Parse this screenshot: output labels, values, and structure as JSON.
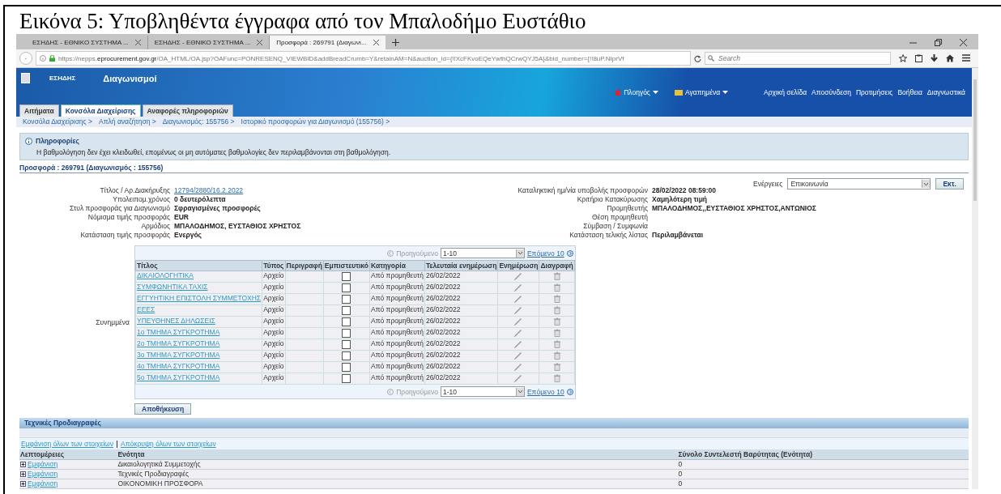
{
  "caption": "Εικόνα 5: Υποβληθέντα έγγραφα από τον Μπαλοδήμο Ευστάθιο",
  "browser": {
    "tabs": [
      {
        "label": "ΕΣΗΔΗΣ - ΕΘΝΙΚΟ ΣΥΣΤΗΜΑ ...",
        "selected": false
      },
      {
        "label": "ΕΣΗΔΗΣ - ΕΘΝΙΚΟ ΣΥΣΤΗΜΑ ...",
        "selected": false
      },
      {
        "label": "Προσφορά : 269791 (Διαγωνι...",
        "selected": true
      }
    ],
    "url_prefix": "https://nepps.",
    "url_domain": "eprocurement.gov.gr",
    "url_rest": "/OA_HTML/OA.jsp?OAFunc=PONRESENQ_VIEWBID&addBreadCrumb=Y&retainAM=N&auction_id={!!XcFKvoEQeYwthQCrwQYJ5A}&bid_number={!!8uP.NIprVf",
    "search_placeholder": "Search"
  },
  "app": {
    "brand": "ΕΣΗΔΗΣ",
    "title": "Διαγωνισμοί",
    "menus": [
      "Πλοηγός",
      "Αγαπημένα"
    ],
    "global_links": [
      "Αρχική σελίδα",
      "Αποσύνδεση",
      "Προτιμήσεις",
      "Βοήθεια",
      "Διαγνωστικά"
    ],
    "tabs": [
      {
        "label": "Αιτήματα",
        "selected": false
      },
      {
        "label": "Κονσόλα Διαχείρισης",
        "selected": true
      },
      {
        "label": "Αναφορές πληροφοριών",
        "selected": false
      }
    ],
    "breadcrumbs": [
      "Κονσόλα Διαχείρισης >",
      "Απλή αναζήτηση >",
      "Διαγωνισμός: 155756 >",
      "Ιστορικό προσφορών για Διαγωνισμό (155756) >"
    ]
  },
  "info": {
    "title": "Πληροφορίες",
    "message": "Η βαθμολόγηση δεν έχει κλειδωθεί, επομένως οι μη αυτόματες βαθμολογίες δεν περιλαμβάνονται στη βαθμολόγηση."
  },
  "offer_heading": "Προσφορά : 269791 (Διαγωνισμός : 155756)",
  "actions": {
    "label": "Ενέργειες",
    "value": "Επικοινωνία",
    "button": "Εκτ."
  },
  "left_fields": [
    {
      "label": "Τίτλος / Αρ.Διακήρυξης",
      "value": "12794/2880/16.2.2022",
      "kind": "link"
    },
    {
      "label": "Υπολειπομ.χρόνος",
      "value": "0 δευτερόλεπτα",
      "kind": "text"
    },
    {
      "label": "Στυλ προσφοράς για Διαγωνισμό",
      "value": "Σφραγισμένες προσφορές",
      "kind": "text"
    },
    {
      "label": "Νόμισμα τιμής προσφοράς",
      "value": "EUR",
      "kind": "text"
    },
    {
      "label": "Αρμόδιος",
      "value": "ΜΠΑΛΟΔΗΜΟΣ, ΕΥΣΤΑΘΙΟΣ ΧΡΗΣΤΟΣ",
      "kind": "text"
    },
    {
      "label": "Κατάσταση τιμής προσφοράς",
      "value": "Ενεργός",
      "kind": "text"
    }
  ],
  "right_fields": [
    {
      "label": "Καταληκτική ημ/νία υποβολής προσφορών",
      "value": "28/02/2022 08:59:00"
    },
    {
      "label": "Κριτήριο Κατακύρωσης",
      "value": "Χαμηλότερη τιμή"
    },
    {
      "label": "Προμηθευτής",
      "value": "ΜΠΑΛΟΔΗΜΟΣ,,ΕΥΣΤΑΘΙΟΣ ΧΡΗΣΤΟΣ,ΑΝΤΩΝΙΟΣ"
    },
    {
      "label": "Θέση προμηθευτή"
    },
    {
      "label": "Σύμβαση / Συμφωνία"
    },
    {
      "label": "Κατάσταση τελικής λίστας",
      "value": "Περιλαμβάνεται"
    }
  ],
  "attachments": {
    "label": "Συνημμένα",
    "pager_top": {
      "previous": "Προηγούμενο",
      "range": "1-10",
      "next": "Επόμενο 10"
    },
    "columns": [
      "Τίτλος",
      "Τύπος",
      "Περιγραφή",
      "Εμπιστευτικό",
      "Κατηγορία",
      "Τελευταία ενημέρωση",
      "Ενημέρωση",
      "Διαγραφή"
    ],
    "rows": [
      {
        "title": "ΔΙΚΑΙΟΛΟΓΗΤΙΚΑ",
        "type": "Αρχείο",
        "confidential": false,
        "category": "Από προμηθευτή",
        "updated": "26/02/2022"
      },
      {
        "title": "ΣΥΜΦΩΝΗΤΙΚΑ ΤΑΧΙΣ",
        "type": "Αρχείο",
        "confidential": false,
        "category": "Από προμηθευτή",
        "updated": "26/02/2022"
      },
      {
        "title": "ΕΓΓΥΗΤΙΚΗ ΕΠΙΣΤΟΛΗ ΣΥΜΜΕΤΟΧΗΣ",
        "type": "Αρχείο",
        "confidential": false,
        "category": "Από προμηθευτή",
        "updated": "26/02/2022"
      },
      {
        "title": "ΕΕΕΣ",
        "type": "Αρχείο",
        "confidential": false,
        "category": "Από προμηθευτή",
        "updated": "26/02/2022"
      },
      {
        "title": "ΥΠΕΥΘΗΝΕΣ ΔΗΛΩΣΕΙΣ",
        "type": "Αρχείο",
        "confidential": false,
        "category": "Από προμηθευτή",
        "updated": "26/02/2022"
      },
      {
        "title": "1ο ΤΜΗΜΑ ΣΥΓΚΡΟΤΗΜΑ",
        "type": "Αρχείο",
        "confidential": false,
        "category": "Από προμηθευτή",
        "updated": "26/02/2022"
      },
      {
        "title": "2ο ΤΜΗΜΑ ΣΥΓΚΡΟΤΗΜΑ",
        "type": "Αρχείο",
        "confidential": false,
        "category": "Από προμηθευτή",
        "updated": "26/02/2022"
      },
      {
        "title": "3ο ΤΜΗΜΑ ΣΥΓΚΡΟΤΗΜΑ",
        "type": "Αρχείο",
        "confidential": false,
        "category": "Από προμηθευτή",
        "updated": "26/02/2022"
      },
      {
        "title": "4ο ΤΜΗΜΑ ΣΥΓΚΡΟΤΗΜΑ",
        "type": "Αρχείο",
        "confidential": false,
        "category": "Από προμηθευτή",
        "updated": "26/02/2022"
      },
      {
        "title": "5ο ΤΜΗΜΑ ΣΥΓΚΡΟΤΗΜΑ",
        "type": "Αρχείο",
        "confidential": false,
        "category": "Από προμηθευτή",
        "updated": "26/02/2022"
      }
    ],
    "pager_bottom": {
      "previous": "Προηγούμενο",
      "range": "1-10",
      "next": "Επόμενο 10"
    }
  },
  "save_button": "Αποθήκευση",
  "tech_spec": {
    "header": "Τεχνικές Προδιαγραφές",
    "show_all": "Εμφάνιση όλων των στοιχείων",
    "hide_all": "Απόκρυψη όλων των στοιχείων",
    "columns": [
      "Λεπτομέρειες",
      "Ενότητα",
      "Σύνολο Συντελεστή Βαρύτητας (Ενότητα)"
    ],
    "rows": [
      {
        "toggle": "Εμφάνιση",
        "expanded": false,
        "section": "Δικαιολογητικά Συμμετοχής",
        "total": "0"
      },
      {
        "toggle": "Εμφάνιση",
        "expanded": false,
        "section": "Τεχνικές Προδιαγραφές",
        "total": "0"
      },
      {
        "toggle": "Εμφάνιση",
        "expanded": false,
        "section": "ΟΙΚΟΝΟΜΙΚΗ ΠΡΟΣΦΟΡΑ",
        "total": "0"
      }
    ]
  }
}
